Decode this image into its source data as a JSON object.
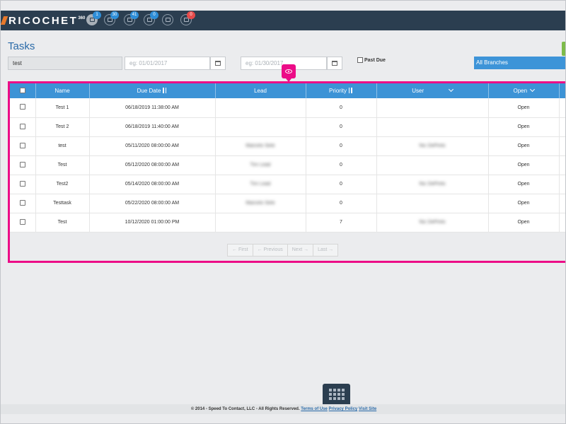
{
  "app": {
    "logo": "RICOCHET",
    "logo_sup": "360"
  },
  "nav": {
    "icons": [
      {
        "name": "dashboard-icon",
        "badge": "1",
        "badge_color": "#2e8ed8",
        "active": true
      },
      {
        "name": "tasks-icon",
        "badge": "30",
        "badge_color": "#2e8ed8"
      },
      {
        "name": "chat-icon",
        "badge": "41",
        "badge_color": "#2e8ed8"
      },
      {
        "name": "mail-icon",
        "badge": "0",
        "badge_color": "#2e8ed8"
      },
      {
        "name": "inbox-icon",
        "badge": "",
        "badge_color": ""
      },
      {
        "name": "message-icon",
        "badge": "0",
        "badge_color": "#e64b4b"
      }
    ]
  },
  "page": {
    "title": "Tasks"
  },
  "filters": {
    "search_value": "test",
    "from_placeholder": "eg: 01/01/2017",
    "to_placeholder": "eg: 01/30/2017",
    "past_due_label": "Past Due",
    "branch_value": "All Branches"
  },
  "table": {
    "headers": {
      "name": "Name",
      "due_date": "Due Date",
      "lead": "Lead",
      "priority": "Priority",
      "user": "User",
      "status": "Open"
    },
    "rows": [
      {
        "name": "Test 1",
        "due": "06/18/2019 11:38:00 AM",
        "lead": "",
        "priority": "0",
        "user": "",
        "status": "Open"
      },
      {
        "name": "Test 2",
        "due": "06/18/2019 11:40:00 AM",
        "lead": "",
        "priority": "0",
        "user": "",
        "status": "Open"
      },
      {
        "name": "test",
        "due": "05/11/2020 08:00:00 AM",
        "lead": "Marcelo Sete",
        "priority": "0",
        "user": "Nic DePinto",
        "status": "Open"
      },
      {
        "name": "Test",
        "due": "05/12/2020 08:00:00 AM",
        "lead": "Tim Lead",
        "priority": "0",
        "user": "",
        "status": "Open"
      },
      {
        "name": "Test2",
        "due": "05/14/2020 08:00:00 AM",
        "lead": "Tim Lead",
        "priority": "0",
        "user": "Nic DePinto",
        "status": "Open"
      },
      {
        "name": "Testtask",
        "due": "05/22/2020 08:00:00 AM",
        "lead": "Marcelo Sete",
        "priority": "0",
        "user": "",
        "status": "Open"
      },
      {
        "name": "Test",
        "due": "10/12/2020 01:00:00 PM",
        "lead": "",
        "priority": "7",
        "user": "Nic DePinto",
        "status": "Open"
      }
    ]
  },
  "pagination": {
    "first": "← First",
    "previous": "← Previous",
    "next": "Next →",
    "last": "Last →"
  },
  "footer": {
    "text": "© 2014 - Speed To Contact, LLC - All Rights Reserved.",
    "terms": "Terms of Use",
    "privacy": "Privacy Policy",
    "visit": "Visit Site"
  },
  "colors": {
    "nav_bg": "#2b3e50",
    "accent_blue": "#3c93d6",
    "highlight": "#ec0c87",
    "title_blue": "#2a6aa8"
  }
}
